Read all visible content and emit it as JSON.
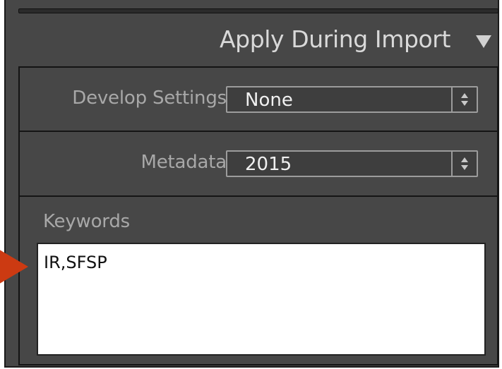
{
  "section": {
    "title": "Apply During Import",
    "disclosure_icon": "triangle-down-icon"
  },
  "develop_settings": {
    "label": "Develop Settings",
    "value": "None",
    "stepper_icon": "up-down-stepper-icon"
  },
  "metadata": {
    "label": "Metadata",
    "value": "2015",
    "stepper_icon": "up-down-stepper-icon"
  },
  "keywords": {
    "label": "Keywords",
    "value": "IR,SFSP"
  },
  "annotation": {
    "pointer_icon": "red-arrow-pointer-icon",
    "color": "#cc3a12"
  },
  "colors": {
    "panel_bg": "#474747",
    "label_text": "#a8a8a8",
    "title_text": "#d9d9d9",
    "field_bg": "#ffffff"
  }
}
